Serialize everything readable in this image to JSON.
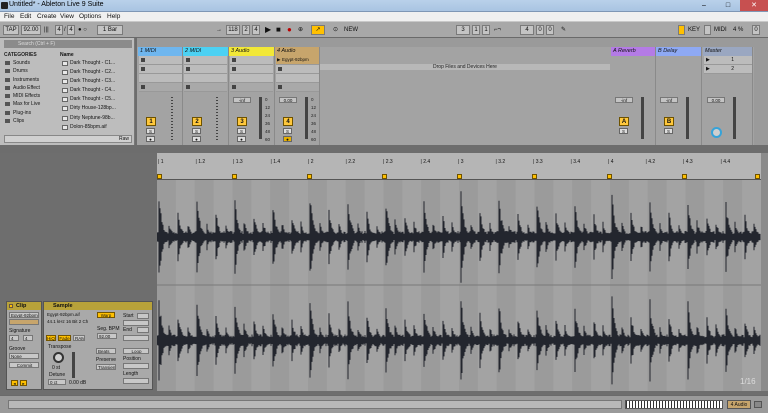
{
  "window": {
    "title": "Untitled* - Ableton Live 9 Suite",
    "minimize": "–",
    "maximize": "□",
    "close": "✕"
  },
  "menu": [
    "File",
    "Edit",
    "Create",
    "View",
    "Options",
    "Help"
  ],
  "transport": {
    "tap": "TAP",
    "tempo": "92.00",
    "sig_num": "4",
    "sig_den": "4",
    "quantize": "1 Bar",
    "position": "118",
    "bar": "2",
    "beat": "4",
    "new_label": "NEW",
    "loop_start": "3",
    "loop_len": "4",
    "loop_bar": "0",
    "key_label": "KEY",
    "midi_label": "MIDI",
    "cpu": "4 %",
    "cpu_value": "0"
  },
  "browser": {
    "search_placeholder": "Search (Ctrl + F)",
    "categories_title": "CATEGORIES",
    "categories": [
      "Sounds",
      "Drums",
      "Instruments",
      "Audio Effect",
      "MIDI Effects",
      "Max for Live",
      "Plug-ins",
      "Clips"
    ],
    "name_title": "Name",
    "files": [
      "Dark Thought - C1...",
      "Dark Thought - C2...",
      "Dark Thought - C3...",
      "Dark Thought - C4...",
      "Dark Thought - C5...",
      "Dirty House-128bp...",
      "Dirty Neptune-98b...",
      "Dolon-85bpm.aif"
    ],
    "raw_label": "Raw"
  },
  "tracks": [
    {
      "name": "1 MIDI",
      "color": "#6fb6ee",
      "num": "1"
    },
    {
      "name": "2 MIDI",
      "color": "#4cd1f3",
      "num": "2"
    },
    {
      "name": "3 Audio",
      "color": "#f2e837",
      "num": "3"
    },
    {
      "name": "4 Audio",
      "color": "#c7a56c",
      "num": "4"
    }
  ],
  "clip_in_slot": "Egypt-92bpm",
  "drop_zone": "Drop Files and Devices Here",
  "returns": [
    {
      "name": "A Reverb",
      "color": "#b47be6",
      "letter": "A"
    },
    {
      "name": "B Delay",
      "color": "#8ea9f4",
      "letter": "B"
    }
  ],
  "master": {
    "name": "Master",
    "color": "#9aa7c1",
    "slot_1": "1",
    "slot_2": "2"
  },
  "mixer": {
    "inf": "-inf",
    "zero": "0.00",
    "s_label": "S",
    "scale": [
      "0",
      "12",
      "24",
      "36",
      "48",
      "60"
    ]
  },
  "clip_panel": {
    "title": "Clip",
    "name": "Egypt-92bpm",
    "signature_label": "Signature",
    "sig_num": "4",
    "sig_den": "4",
    "groove_label": "Groove",
    "groove": "None",
    "commit_label": "Commit"
  },
  "sample_panel": {
    "title": "Sample",
    "file": "Egypt-92bpm.aif",
    "info": "44.1 kHz 16 Bit 2 Ch",
    "warp": "Warp",
    "start_label": "Start",
    "end_label": "End",
    "hiq": "HiQ",
    "fade": "Fade",
    "ram": "RAM",
    "transpose_label": "Transpose",
    "transpose": "0 st",
    "detune_label": "Detune",
    "detune": "0 ct",
    "gain": "0.00 dB",
    "seg_bpm_label": "Seg. BPM",
    "seg_bpm": "92.00",
    "beats": "Beats",
    "loop_label": "Loop",
    "position_label": "Position",
    "preserve_label": "Preserve",
    "transients": "Transien",
    "length_label": "Length"
  },
  "ruler": {
    "ticks": [
      "1",
      "1.2",
      "1.3",
      "1.4",
      "2",
      "2.2",
      "2.3",
      "2.4",
      "3",
      "3.2",
      "3.3",
      "3.4",
      "4",
      "4.2",
      "4.3",
      "4.4"
    ]
  },
  "status": {
    "zoom": "1/16",
    "track_label": "4 Audio"
  }
}
